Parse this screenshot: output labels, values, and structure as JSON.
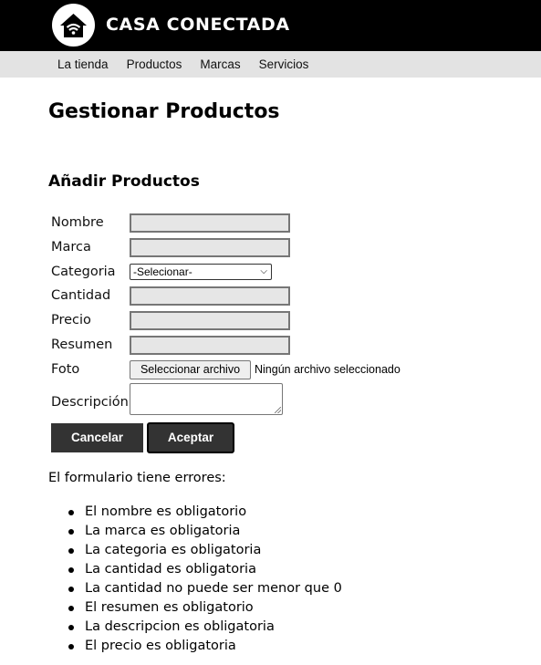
{
  "header": {
    "brand": "CASA CONECTADA",
    "logo_icon": "smart-home-wifi-icon"
  },
  "nav": {
    "items": [
      "La tienda",
      "Productos",
      "Marcas",
      "Servicios"
    ]
  },
  "page": {
    "title": "Gestionar Productos",
    "section_title": "Añadir Productos"
  },
  "form": {
    "nombre_label": "Nombre",
    "nombre_value": "",
    "marca_label": "Marca",
    "marca_value": "",
    "categoria_label": "Categoria",
    "categoria_selected": "-Selecionar-",
    "cantidad_label": "Cantidad",
    "cantidad_value": "",
    "precio_label": "Precio",
    "precio_value": "",
    "resumen_label": "Resumen",
    "resumen_value": "",
    "foto_label": "Foto",
    "foto_button": "Seleccionar archivo",
    "foto_status": "Ningún archivo seleccionado",
    "descripcion_label": "Descripción",
    "descripcion_value": "",
    "cancel_label": "Cancelar",
    "accept_label": "Aceptar"
  },
  "errors": {
    "title": "El formulario tiene errores:",
    "items": [
      "El nombre es obligatorio",
      "La marca es obligatoria",
      "La categoria es obligatoria",
      "La cantidad es obligatoria",
      "La cantidad no puede ser menor que 0",
      "El resumen es obligatorio",
      "La descripcion es obligatoria",
      "El precio es obligatoria"
    ]
  },
  "colors": {
    "topbar": "#000000",
    "navbar": "#e3e3e3",
    "button": "#333333",
    "input_bg": "#e6e6e6"
  }
}
